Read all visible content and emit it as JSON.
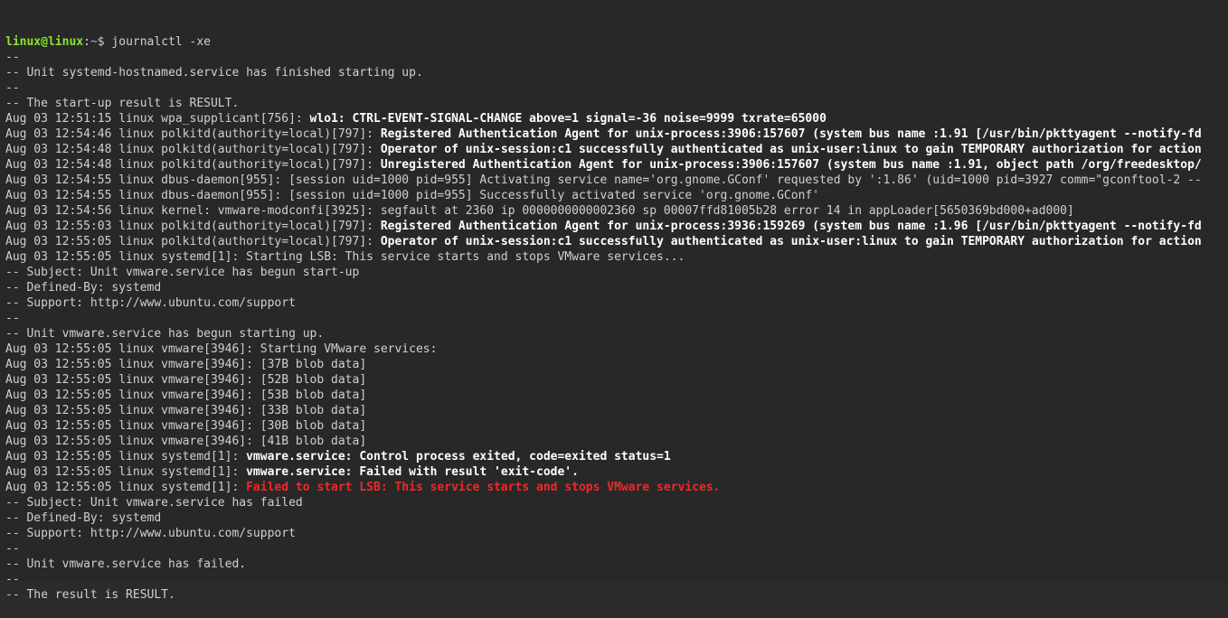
{
  "prompt": {
    "user": "linux",
    "at": "@",
    "host": "linux",
    "colon": ":",
    "path": "~",
    "dollar": "$ ",
    "command": "journalctl -xe"
  },
  "lines": [
    {
      "segs": [
        {
          "cls": "dim",
          "t": "-- "
        }
      ]
    },
    {
      "segs": [
        {
          "cls": "dim",
          "t": "-- Unit systemd-hostnamed.service has finished starting up."
        }
      ]
    },
    {
      "segs": [
        {
          "cls": "dim",
          "t": "-- "
        }
      ]
    },
    {
      "segs": [
        {
          "cls": "dim",
          "t": "-- The start-up result is RESULT."
        }
      ]
    },
    {
      "segs": [
        {
          "cls": "dim",
          "t": "Aug 03 12:51:15 linux wpa_supplicant[756]: "
        },
        {
          "cls": "bold",
          "t": "wlo1: CTRL-EVENT-SIGNAL-CHANGE above=1 signal=-36 noise=9999 txrate=65000"
        }
      ]
    },
    {
      "segs": [
        {
          "cls": "dim",
          "t": "Aug 03 12:54:46 linux polkitd(authority=local)[797]: "
        },
        {
          "cls": "bold",
          "t": "Registered Authentication Agent for unix-process:3906:157607 (system bus name :1.91 [/usr/bin/pkttyagent --notify-fd"
        }
      ]
    },
    {
      "segs": [
        {
          "cls": "dim",
          "t": "Aug 03 12:54:48 linux polkitd(authority=local)[797]: "
        },
        {
          "cls": "bold",
          "t": "Operator of unix-session:c1 successfully authenticated as unix-user:linux to gain TEMPORARY authorization for action"
        }
      ]
    },
    {
      "segs": [
        {
          "cls": "dim",
          "t": "Aug 03 12:54:48 linux polkitd(authority=local)[797]: "
        },
        {
          "cls": "bold",
          "t": "Unregistered Authentication Agent for unix-process:3906:157607 (system bus name :1.91, object path /org/freedesktop/"
        }
      ]
    },
    {
      "segs": [
        {
          "cls": "dim",
          "t": "Aug 03 12:54:55 linux dbus-daemon[955]: [session uid=1000 pid=955] Activating service name='org.gnome.GConf' requested by ':1.86' (uid=1000 pid=3927 comm=\"gconftool-2 --"
        }
      ]
    },
    {
      "segs": [
        {
          "cls": "dim",
          "t": "Aug 03 12:54:55 linux dbus-daemon[955]: [session uid=1000 pid=955] Successfully activated service 'org.gnome.GConf'"
        }
      ]
    },
    {
      "segs": [
        {
          "cls": "dim",
          "t": "Aug 03 12:54:56 linux kernel: vmware-modconfi[3925]: segfault at 2360 ip 0000000000002360 sp 00007ffd81005b28 error 14 in appLoader[5650369bd000+ad000]"
        }
      ]
    },
    {
      "segs": [
        {
          "cls": "dim",
          "t": "Aug 03 12:55:03 linux polkitd(authority=local)[797]: "
        },
        {
          "cls": "bold",
          "t": "Registered Authentication Agent for unix-process:3936:159269 (system bus name :1.96 [/usr/bin/pkttyagent --notify-fd"
        }
      ]
    },
    {
      "segs": [
        {
          "cls": "dim",
          "t": "Aug 03 12:55:05 linux polkitd(authority=local)[797]: "
        },
        {
          "cls": "bold",
          "t": "Operator of unix-session:c1 successfully authenticated as unix-user:linux to gain TEMPORARY authorization for action"
        }
      ]
    },
    {
      "segs": [
        {
          "cls": "dim",
          "t": "Aug 03 12:55:05 linux systemd[1]: Starting LSB: This service starts and stops VMware services..."
        }
      ]
    },
    {
      "segs": [
        {
          "cls": "dim",
          "t": "-- Subject: Unit vmware.service has begun start-up"
        }
      ]
    },
    {
      "segs": [
        {
          "cls": "dim",
          "t": "-- Defined-By: systemd"
        }
      ]
    },
    {
      "segs": [
        {
          "cls": "dim",
          "t": "-- Support: http://www.ubuntu.com/support"
        }
      ]
    },
    {
      "segs": [
        {
          "cls": "dim",
          "t": "-- "
        }
      ]
    },
    {
      "segs": [
        {
          "cls": "dim",
          "t": "-- Unit vmware.service has begun starting up."
        }
      ]
    },
    {
      "segs": [
        {
          "cls": "dim",
          "t": "Aug 03 12:55:05 linux vmware[3946]: Starting VMware services:"
        }
      ]
    },
    {
      "segs": [
        {
          "cls": "dim",
          "t": "Aug 03 12:55:05 linux vmware[3946]: [37B blob data]"
        }
      ]
    },
    {
      "segs": [
        {
          "cls": "dim",
          "t": "Aug 03 12:55:05 linux vmware[3946]: [52B blob data]"
        }
      ]
    },
    {
      "segs": [
        {
          "cls": "dim",
          "t": "Aug 03 12:55:05 linux vmware[3946]: [53B blob data]"
        }
      ]
    },
    {
      "segs": [
        {
          "cls": "dim",
          "t": "Aug 03 12:55:05 linux vmware[3946]: [33B blob data]"
        }
      ]
    },
    {
      "segs": [
        {
          "cls": "dim",
          "t": "Aug 03 12:55:05 linux vmware[3946]: [30B blob data]"
        }
      ]
    },
    {
      "segs": [
        {
          "cls": "dim",
          "t": "Aug 03 12:55:05 linux vmware[3946]: [41B blob data]"
        }
      ]
    },
    {
      "segs": [
        {
          "cls": "dim",
          "t": "Aug 03 12:55:05 linux systemd[1]: "
        },
        {
          "cls": "bold",
          "t": "vmware.service: Control process exited, code=exited status=1"
        }
      ]
    },
    {
      "segs": [
        {
          "cls": "dim",
          "t": "Aug 03 12:55:05 linux systemd[1]: "
        },
        {
          "cls": "bold",
          "t": "vmware.service: Failed with result 'exit-code'."
        }
      ]
    },
    {
      "segs": [
        {
          "cls": "dim",
          "t": "Aug 03 12:55:05 linux systemd[1]: "
        },
        {
          "cls": "red",
          "t": "Failed to start LSB: This service starts and stops VMware services."
        }
      ]
    },
    {
      "segs": [
        {
          "cls": "dim",
          "t": "-- Subject: Unit vmware.service has failed"
        }
      ]
    },
    {
      "segs": [
        {
          "cls": "dim",
          "t": "-- Defined-By: systemd"
        }
      ]
    },
    {
      "segs": [
        {
          "cls": "dim",
          "t": "-- Support: http://www.ubuntu.com/support"
        }
      ]
    },
    {
      "segs": [
        {
          "cls": "dim",
          "t": "-- "
        }
      ]
    },
    {
      "segs": [
        {
          "cls": "dim",
          "t": "-- Unit vmware.service has failed."
        }
      ]
    },
    {
      "segs": [
        {
          "cls": "dim",
          "t": "-- "
        }
      ]
    },
    {
      "segs": [
        {
          "cls": "dim",
          "t": "-- The result is RESULT."
        }
      ]
    }
  ]
}
